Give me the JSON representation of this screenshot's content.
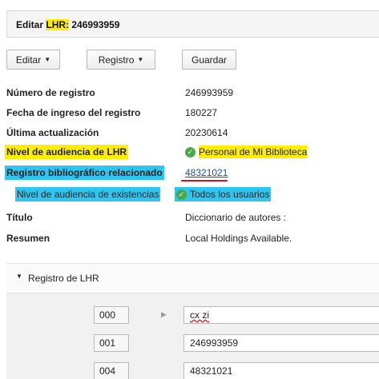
{
  "header": {
    "prefix": "Editar",
    "highlighted": "LHR:",
    "record_number": "246993959"
  },
  "toolbar": {
    "edit_label": "Editar",
    "record_label": "Registro",
    "save_label": "Guardar"
  },
  "fields": {
    "record_number_label": "Número de registro",
    "record_number_value": "246993959",
    "entry_date_label": "Fecha de ingreso del registro",
    "entry_date_value": "180227",
    "last_update_label": "Última actualización",
    "last_update_value": "20230614",
    "audience_label": "Nivel de audiencia de LHR",
    "audience_value": "Personal de Mi Biblioteca",
    "biblio_label": "Registro bibliográfico relacionado",
    "biblio_value": "48321021",
    "holdings_audience_label": "Nivel de audiencia de existencias",
    "holdings_audience_value": "Todos los usuarios",
    "title_label": "Título",
    "title_value": "Diccionario de autores :",
    "summary_label": "Resumen",
    "summary_value": "Local Holdings Available."
  },
  "record_section": {
    "title": "Registro de LHR",
    "rows": [
      {
        "tag": "000",
        "value": "cx  zi"
      },
      {
        "tag": "001",
        "value": "246993959"
      },
      {
        "tag": "004",
        "value": "48321021"
      }
    ]
  },
  "colors": {
    "highlight_yellow": "#ffee00",
    "highlight_cyan": "#2ec6f0",
    "underline_red": "#d0101a",
    "link_blue": "#1a4fb0",
    "check_green": "#4aa84a"
  }
}
